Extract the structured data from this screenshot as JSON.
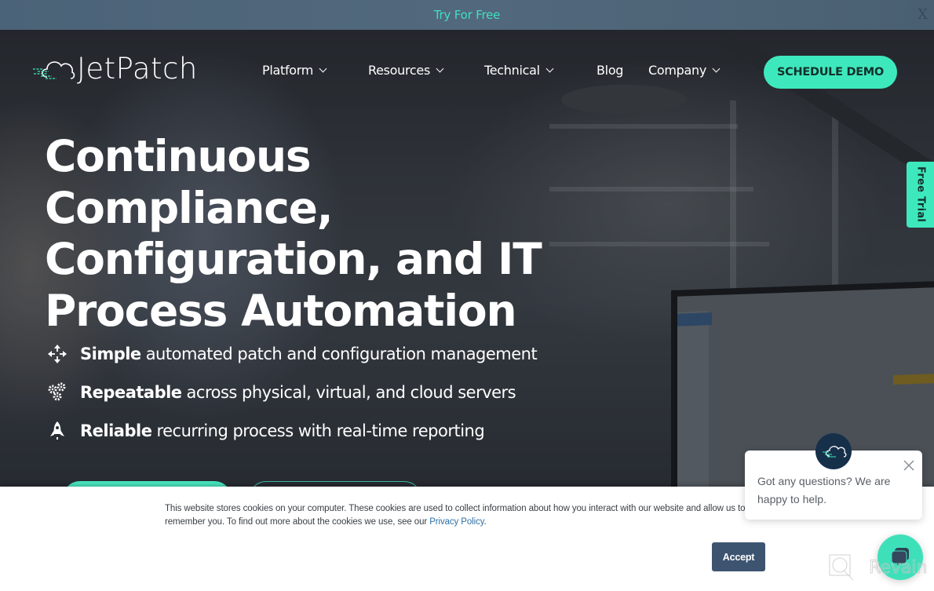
{
  "promo_bar": {
    "link_label": "Try For Free",
    "close_label": "X"
  },
  "brand": {
    "name": "JetPatch",
    "accent_color": "#3ee8bd",
    "dark_color": "#3c5470"
  },
  "nav": {
    "items": [
      {
        "label": "Platform",
        "has_dropdown": true
      },
      {
        "label": "Resources",
        "has_dropdown": true
      },
      {
        "label": "Technical",
        "has_dropdown": true
      },
      {
        "label": "Blog",
        "has_dropdown": false
      },
      {
        "label": "Company",
        "has_dropdown": true
      }
    ],
    "cta_label": "SCHEDULE DEMO"
  },
  "side_tab": {
    "label": "Free Trial"
  },
  "hero": {
    "headline_lines": [
      "Continuous",
      "Compliance,",
      "Configuration, and IT",
      "Process Automation"
    ],
    "features": [
      {
        "icon": "arrows-move-icon",
        "bold": "Simple",
        "text": "automated patch and configuration management"
      },
      {
        "icon": "gears-icon",
        "bold": "Repeatable",
        "text": "across physical, virtual, and cloud servers"
      },
      {
        "icon": "rocket-icon",
        "bold": "Reliable",
        "text": "recurring process with real-time reporting"
      }
    ]
  },
  "cookie_banner": {
    "text_part1": "This website stores cookies on your computer. These cookies are used to collect information about how you interact with our website and allow us to remember you. To find out more about the cookies we use, see our ",
    "policy_link": "Privacy Policy",
    "text_part2": ".",
    "accept_label": "Accept"
  },
  "chat": {
    "message": "Got any questions? We are happy to help."
  },
  "watermark": {
    "text": "Revain"
  }
}
